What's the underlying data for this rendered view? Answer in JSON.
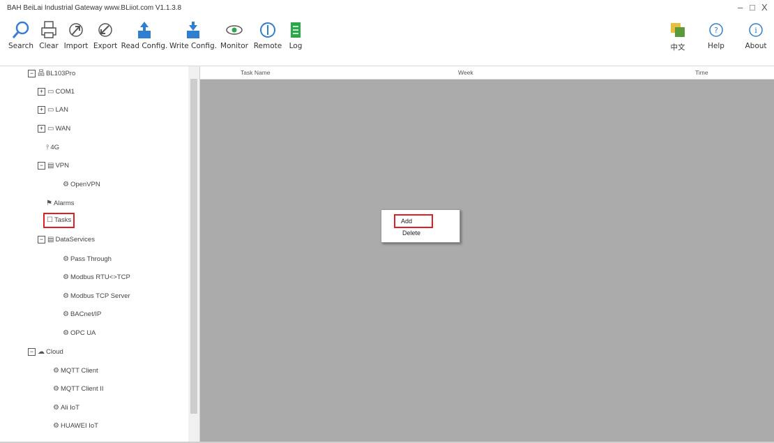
{
  "window": {
    "title": "BAH BeiLai Industrial Gateway www.BLiiot.com V1.1.3.8",
    "minimize": "–",
    "maximize": "□",
    "close": "X"
  },
  "toolbar": {
    "search": "Search",
    "clear": "Clear",
    "import": "Import",
    "export": "Export",
    "read_config": "Read Config.",
    "write_config": "Write Config.",
    "monitor": "Monitor",
    "remote": "Remote",
    "log": "Log",
    "language": "中文",
    "help": "Help",
    "about": "About"
  },
  "tree": {
    "root": "BL103Pro",
    "com1": "COM1",
    "lan": "LAN",
    "wan": "WAN",
    "fourg": "4G",
    "vpn": "VPN",
    "openvpn": "OpenVPN",
    "alarms": "Alarms",
    "tasks": "Tasks",
    "dataservices": "DataServices",
    "passthrough": "Pass Through",
    "modbus_rtu_tcp": "Modbus RTU<>TCP",
    "modbus_tcp_server": "Modbus TCP Server",
    "bacnet": "BACnet/IP",
    "opcua": "OPC UA",
    "cloud": "Cloud",
    "mqtt1": "MQTT Client",
    "mqtt2": "MQTT Client II",
    "ali": "Ali IoT",
    "huawei": "HUAWEI IoT"
  },
  "table": {
    "col_task": "Task Name",
    "col_week": "Week",
    "col_time": "Time"
  },
  "context_menu": {
    "add": "Add",
    "delete": "Delete"
  }
}
